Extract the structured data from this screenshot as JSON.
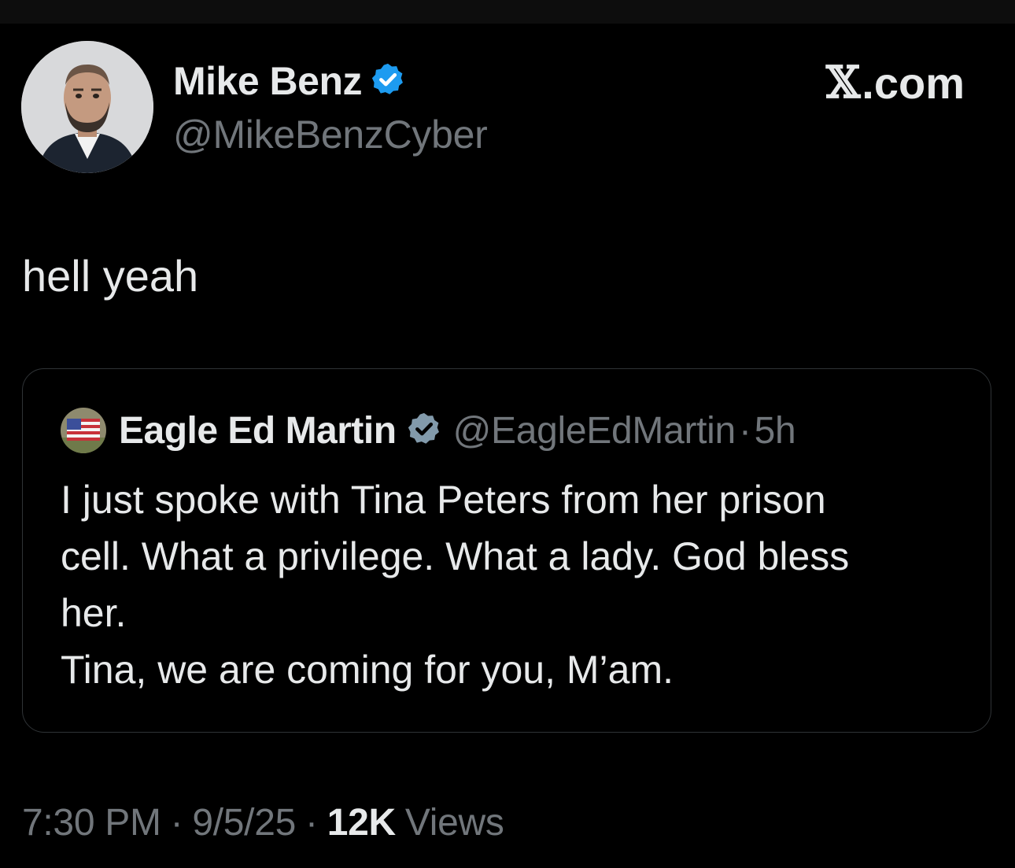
{
  "tweet": {
    "author": {
      "name": "Mike Benz",
      "handle": "@MikeBenzCyber",
      "verified_color": "#1d9bf0"
    },
    "brand": {
      "mark": "𝕏",
      "domain": ".com"
    },
    "text": "hell yeah",
    "quoted": {
      "author": {
        "name": "Eagle Ed Martin",
        "handle": "@EagleEdMartin",
        "separator": "·",
        "time": "5h",
        "verified_color": "#829aab"
      },
      "lines": [
        "I just spoke with Tina Peters from her prison",
        "cell. What a privilege. What a lady. God bless",
        "her.",
        "Tina, we are coming for you, M’am."
      ]
    },
    "meta": {
      "time": "7:30 PM",
      "separator": "·",
      "date": "9/5/25",
      "views_count": "12K",
      "views_label": "Views"
    }
  },
  "icons": {
    "author_avatar": "avatar-photo",
    "author_verified": "verified-badge-icon",
    "quoted_avatar": "flag-avatar",
    "quoted_verified": "verified-badge-icon"
  },
  "colors": {
    "background": "#000000",
    "primary_text": "#e7e9ea",
    "secondary_text": "#71767b",
    "card_border": "#2f3336"
  }
}
